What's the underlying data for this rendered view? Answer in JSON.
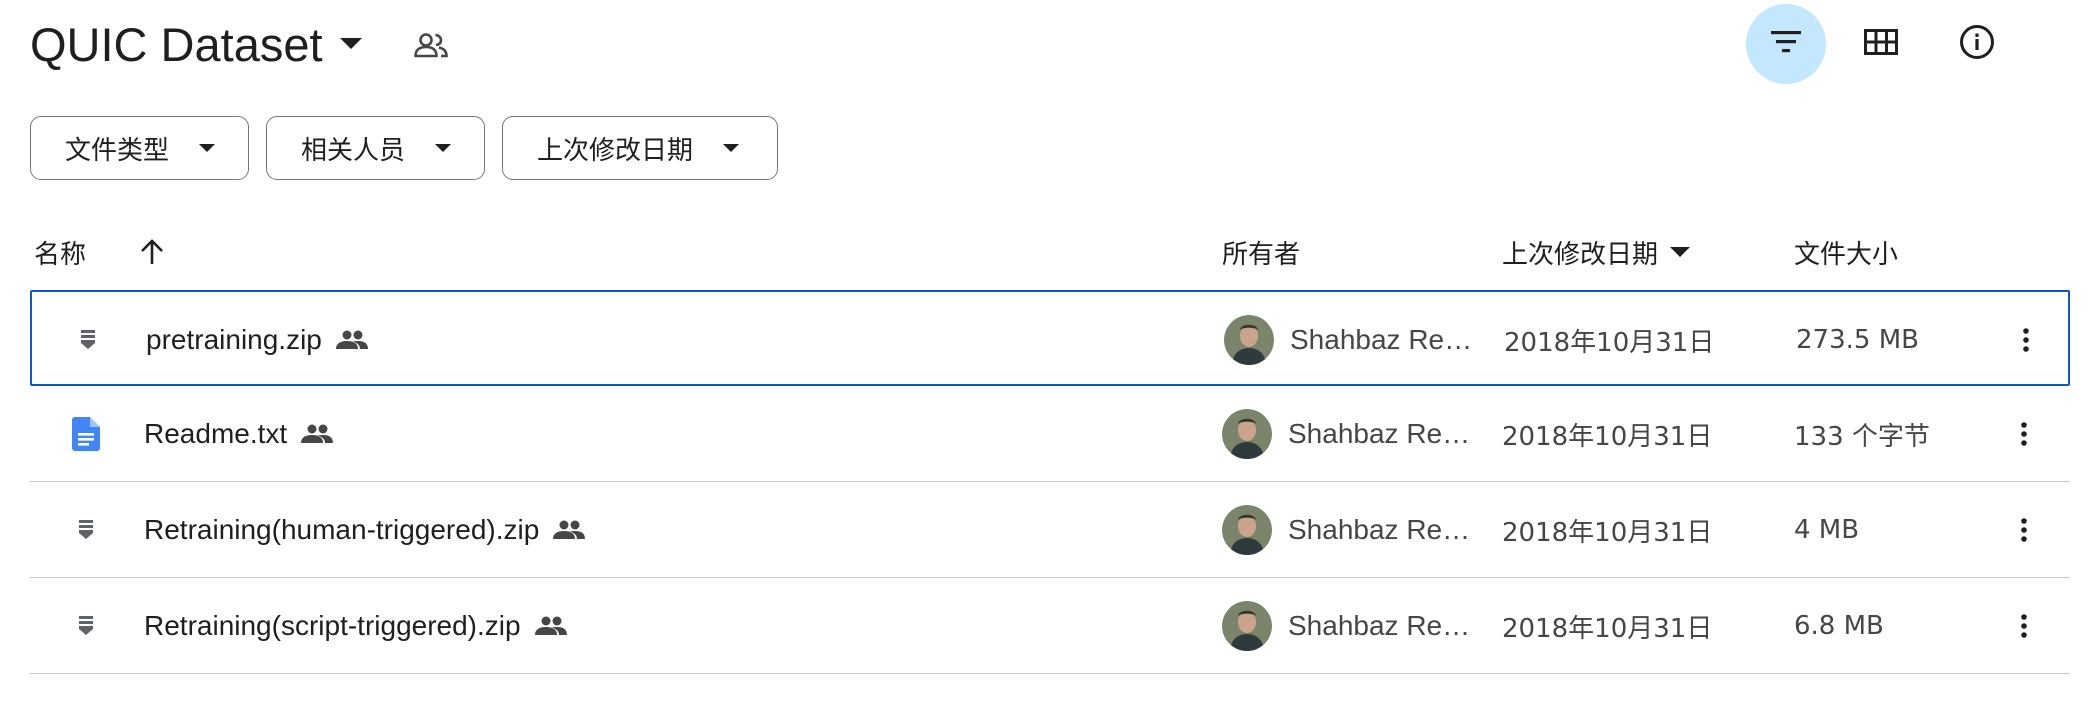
{
  "header": {
    "title": "QUIC Dataset",
    "icons": {
      "title_dropdown": "arrow-drop-down-icon",
      "shared_folder": "people-outline-icon",
      "filter": "filter-list-icon",
      "grid_view": "grid-view-icon",
      "info": "info-outline-icon"
    },
    "filter_active": true,
    "accent_color": "#c2e7ff"
  },
  "filters": [
    {
      "label": "文件类型"
    },
    {
      "label": "相关人员"
    },
    {
      "label": "上次修改日期"
    }
  ],
  "columns": {
    "name": "名称",
    "name_sort": "ascending",
    "owner": "所有者",
    "modified": "上次修改日期",
    "modified_sort": "descending",
    "size": "文件大小"
  },
  "rows": [
    {
      "name": "pretraining.zip",
      "type": "zip",
      "icon": "zip-archive-icon",
      "shared": true,
      "owner": "Shahbaz Rezaei",
      "modified": "2018年10月31日",
      "size": "273.5 MB",
      "selected": true
    },
    {
      "name": "Readme.txt",
      "type": "doc",
      "icon": "document-icon",
      "shared": true,
      "owner": "Shahbaz Rezaei",
      "modified": "2018年10月31日",
      "size": "133 个字节",
      "selected": false
    },
    {
      "name": "Retraining(human-triggered).zip",
      "type": "zip",
      "icon": "zip-archive-icon",
      "shared": true,
      "owner": "Shahbaz Rezaei",
      "modified": "2018年10月31日",
      "size": "4 MB",
      "selected": false
    },
    {
      "name": "Retraining(script-triggered).zip",
      "type": "zip",
      "icon": "zip-archive-icon",
      "shared": true,
      "owner": "Shahbaz Rezaei",
      "modified": "2018年10月31日",
      "size": "6.8 MB",
      "selected": false
    }
  ],
  "colors": {
    "selection_border": "#0b57d0",
    "doc_icon": "#4285f4",
    "divider": "#c4c7c5"
  }
}
